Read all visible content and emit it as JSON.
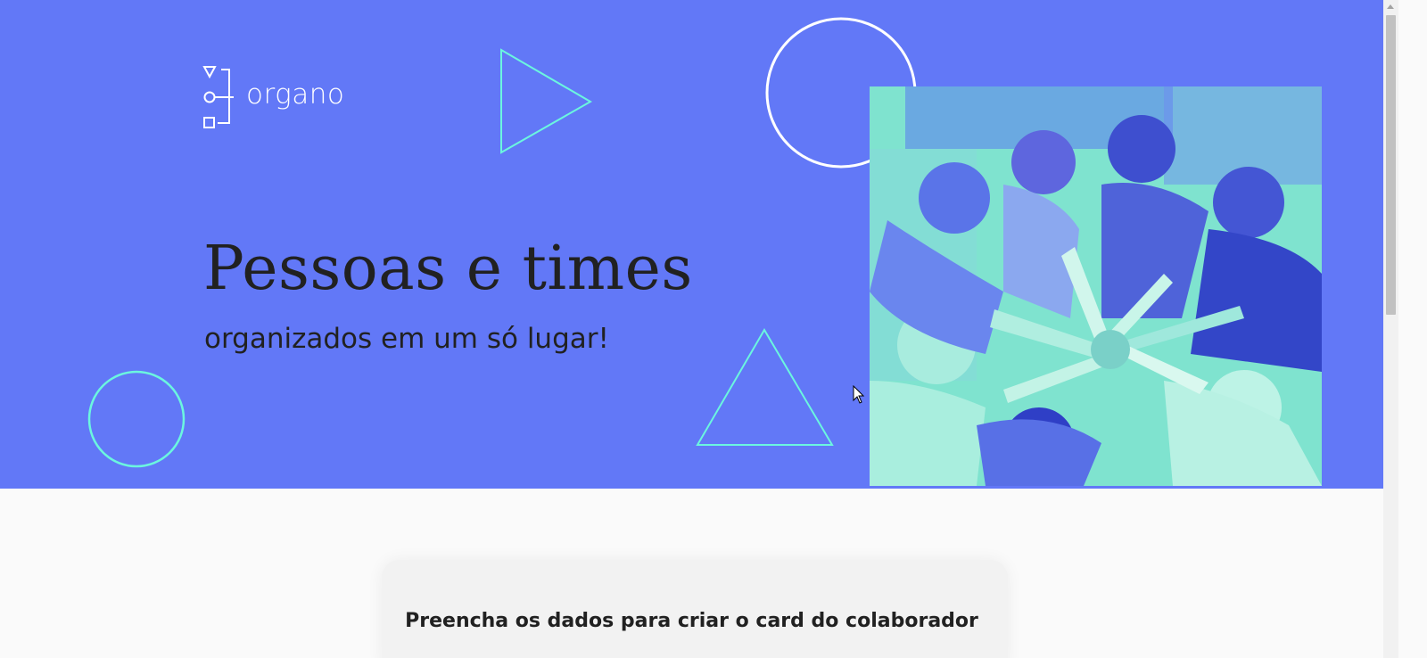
{
  "header": {
    "logo_text": "organo",
    "title": "Pessoas e times",
    "subtitle": "organizados em um só lugar!",
    "banner_image_alt": "team-hands-together-photo"
  },
  "form": {
    "heading": "Preencha os dados para criar o card do colaborador"
  },
  "colors": {
    "banner_bg": "#6278F7",
    "accent_cyan": "#6BF6DF",
    "text_dark": "#212121",
    "page_bg": "#FAFAFA"
  }
}
